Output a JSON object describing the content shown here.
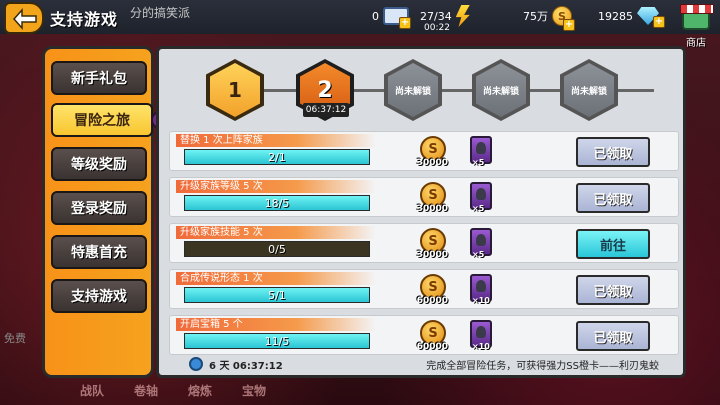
{
  "header": {
    "title": "支持游戏",
    "banner_text": "分的搞笑派",
    "tickets": "0",
    "energy": "27/34",
    "energy_timer": "00:22",
    "gold": "75万",
    "gold_symbol": "S",
    "gems": "19285",
    "shop_label": "商店"
  },
  "sidebar": {
    "items": [
      {
        "label": "新手礼包"
      },
      {
        "label": "冒险之旅"
      },
      {
        "label": "等级奖励"
      },
      {
        "label": "登录奖励"
      },
      {
        "label": "特惠首充"
      },
      {
        "label": "支持游戏"
      }
    ]
  },
  "stages": {
    "hex1": "1",
    "hex2": "2",
    "locked": "尚未解锁",
    "timer": "06:37:12"
  },
  "tasks": [
    {
      "label": "替换 1 次上阵家族",
      "progress": "2/1",
      "coin": "30000",
      "coin_symbol": "S",
      "card": "×5",
      "button": "已领取",
      "fill": 1.0
    },
    {
      "label": "升级家族等级 5 次",
      "progress": "18/5",
      "coin": "30000",
      "coin_symbol": "S",
      "card": "×5",
      "button": "已领取",
      "fill": 1.0
    },
    {
      "label": "升级家族技能 5 次",
      "progress": "0/5",
      "coin": "30000",
      "coin_symbol": "S",
      "card": "×5",
      "button": "前往",
      "fill": 0.0
    },
    {
      "label": "合成传说形态 1 次",
      "progress": "5/1",
      "coin": "60000",
      "coin_symbol": "S",
      "card": "×10",
      "button": "已领取",
      "fill": 1.0
    },
    {
      "label": "开启宝箱 5 个",
      "progress": "11/5",
      "coin": "60000",
      "coin_symbol": "S",
      "card": "×10",
      "button": "已领取",
      "fill": 1.0
    }
  ],
  "footer": {
    "countdown": "6 天 06:37:12",
    "note": "完成全部冒险任务，可获得强力SS橙卡——利刃鬼蛟"
  },
  "bottom_nav": [
    "战队",
    "卷轴",
    "熔炼",
    "宝物"
  ],
  "left_fade": "免费"
}
